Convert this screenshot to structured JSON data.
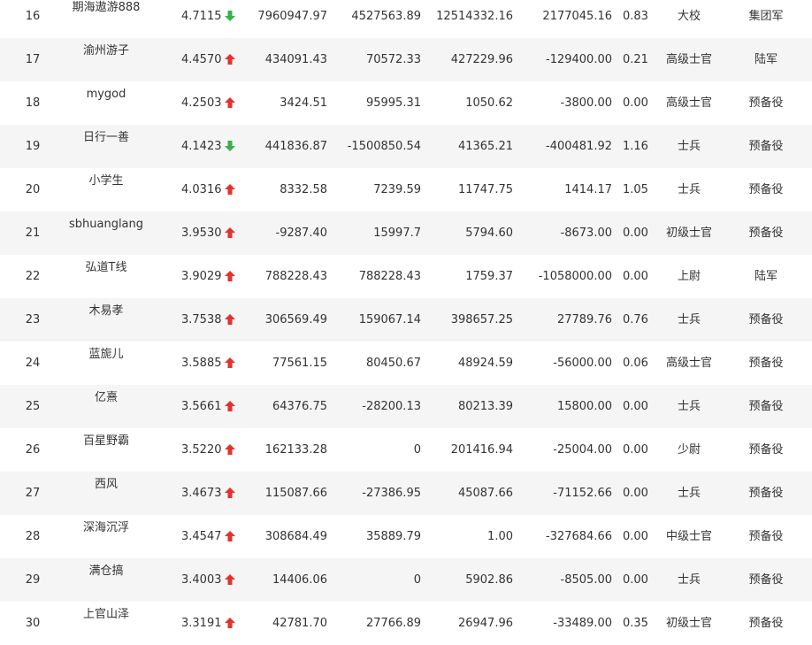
{
  "colors": {
    "row_alt_bg": "#f5f5f5",
    "text": "#333333",
    "arrow_up": "#e5302f",
    "arrow_down": "#37b24d"
  },
  "rows": [
    {
      "rank": "16",
      "name": "期海遨游888",
      "score": "4.7115",
      "trend": "down",
      "trend_icon": "arrow-down-icon",
      "v1": "7960947.97",
      "v2": "4527563.89",
      "v3": "12514332.16",
      "v4": "2177045.16",
      "ratio": "0.83",
      "title": "大校",
      "branch": "集团军"
    },
    {
      "rank": "17",
      "name": "渝州游子",
      "score": "4.4570",
      "trend": "up",
      "trend_icon": "arrow-up-icon",
      "v1": "434091.43",
      "v2": "70572.33",
      "v3": "427229.96",
      "v4": "-129400.00",
      "ratio": "0.21",
      "title": "高级士官",
      "branch": "陆军"
    },
    {
      "rank": "18",
      "name": "mygod",
      "score": "4.2503",
      "trend": "up",
      "trend_icon": "arrow-up-icon",
      "v1": "3424.51",
      "v2": "95995.31",
      "v3": "1050.62",
      "v4": "-3800.00",
      "ratio": "0.00",
      "title": "高级士官",
      "branch": "预备役"
    },
    {
      "rank": "19",
      "name": "日行一善",
      "score": "4.1423",
      "trend": "down",
      "trend_icon": "arrow-down-icon",
      "v1": "441836.87",
      "v2": "-1500850.54",
      "v3": "41365.21",
      "v4": "-400481.92",
      "ratio": "1.16",
      "title": "士兵",
      "branch": "预备役"
    },
    {
      "rank": "20",
      "name": "小学生",
      "score": "4.0316",
      "trend": "up",
      "trend_icon": "arrow-up-icon",
      "v1": "8332.58",
      "v2": "7239.59",
      "v3": "11747.75",
      "v4": "1414.17",
      "ratio": "1.05",
      "title": "士兵",
      "branch": "预备役"
    },
    {
      "rank": "21",
      "name": "sbhuanglang",
      "score": "3.9530",
      "trend": "up",
      "trend_icon": "arrow-up-icon",
      "v1": "-9287.40",
      "v2": "15997.7",
      "v3": "5794.60",
      "v4": "-8673.00",
      "ratio": "0.00",
      "title": "初级士官",
      "branch": "预备役"
    },
    {
      "rank": "22",
      "name": "弘道T线",
      "score": "3.9029",
      "trend": "up",
      "trend_icon": "arrow-up-icon",
      "v1": "788228.43",
      "v2": "788228.43",
      "v3": "1759.37",
      "v4": "-1058000.00",
      "ratio": "0.00",
      "title": "上尉",
      "branch": "陆军"
    },
    {
      "rank": "23",
      "name": "木易孝",
      "score": "3.7538",
      "trend": "up",
      "trend_icon": "arrow-up-icon",
      "v1": "306569.49",
      "v2": "159067.14",
      "v3": "398657.25",
      "v4": "27789.76",
      "ratio": "0.76",
      "title": "士兵",
      "branch": "预备役"
    },
    {
      "rank": "24",
      "name": "蓝旎儿",
      "score": "3.5885",
      "trend": "up",
      "trend_icon": "arrow-up-icon",
      "v1": "77561.15",
      "v2": "80450.67",
      "v3": "48924.59",
      "v4": "-56000.00",
      "ratio": "0.06",
      "title": "高级士官",
      "branch": "预备役"
    },
    {
      "rank": "25",
      "name": "亿熹",
      "score": "3.5661",
      "trend": "up",
      "trend_icon": "arrow-up-icon",
      "v1": "64376.75",
      "v2": "-28200.13",
      "v3": "80213.39",
      "v4": "15800.00",
      "ratio": "0.00",
      "title": "士兵",
      "branch": "预备役"
    },
    {
      "rank": "26",
      "name": "百星野霸",
      "score": "3.5220",
      "trend": "up",
      "trend_icon": "arrow-up-icon",
      "v1": "162133.28",
      "v2": "0",
      "v3": "201416.94",
      "v4": "-25004.00",
      "ratio": "0.00",
      "title": "少尉",
      "branch": "预备役"
    },
    {
      "rank": "27",
      "name": "西风",
      "score": "3.4673",
      "trend": "up",
      "trend_icon": "arrow-up-icon",
      "v1": "115087.66",
      "v2": "-27386.95",
      "v3": "45087.66",
      "v4": "-71152.66",
      "ratio": "0.00",
      "title": "士兵",
      "branch": "预备役"
    },
    {
      "rank": "28",
      "name": "深海沉浮",
      "score": "3.4547",
      "trend": "up",
      "trend_icon": "arrow-up-icon",
      "v1": "308684.49",
      "v2": "35889.79",
      "v3": "1.00",
      "v4": "-327684.66",
      "ratio": "0.00",
      "title": "中级士官",
      "branch": "预备役"
    },
    {
      "rank": "29",
      "name": "满仓搞",
      "score": "3.4003",
      "trend": "up",
      "trend_icon": "arrow-up-icon",
      "v1": "14406.06",
      "v2": "0",
      "v3": "5902.86",
      "v4": "-8505.00",
      "ratio": "0.00",
      "title": "士兵",
      "branch": "预备役"
    },
    {
      "rank": "30",
      "name": "上官山泽",
      "score": "3.3191",
      "trend": "up",
      "trend_icon": "arrow-up-icon",
      "v1": "42781.70",
      "v2": "27766.89",
      "v3": "26947.96",
      "v4": "-33489.00",
      "ratio": "0.35",
      "title": "初级士官",
      "branch": "预备役"
    }
  ]
}
